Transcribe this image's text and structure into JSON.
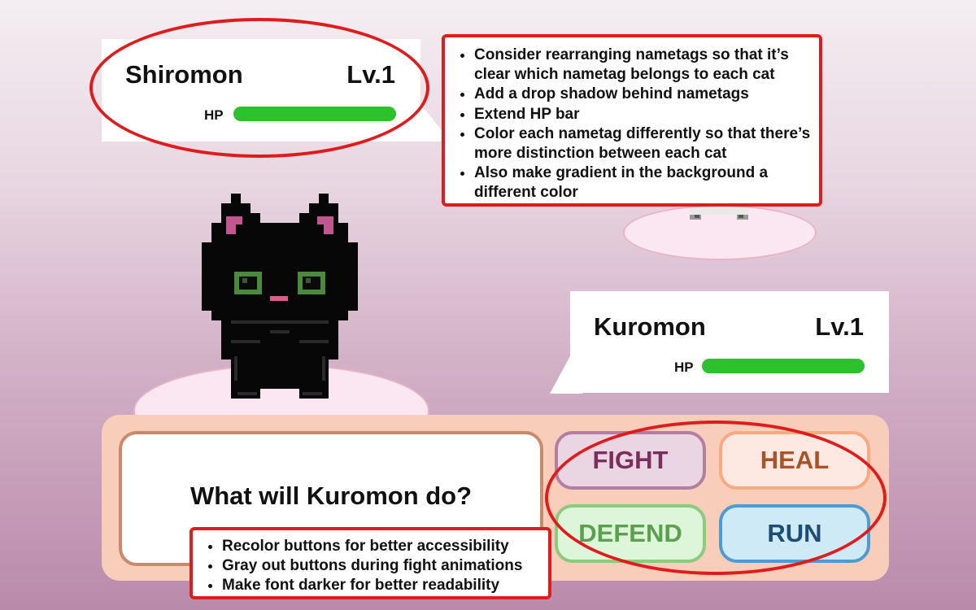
{
  "enemy": {
    "name": "Shiromon",
    "level": "Lv.1",
    "hp_label": "HP",
    "hp_fraction": 1.0
  },
  "player": {
    "name": "Kuromon",
    "level": "Lv.1",
    "hp_label": "HP",
    "hp_fraction": 1.0
  },
  "battle": {
    "prompt": "What will Kuromon do?",
    "buttons": {
      "fight": "FIGHT",
      "heal": "HEAL",
      "defend": "DEFEND",
      "run": "RUN"
    }
  },
  "annotations": {
    "top_notes": [
      "Consider rearranging nametags so that it’s clear which nametag belongs to each cat",
      "Add a drop shadow behind nametags",
      "Extend HP bar",
      "Color each nametag differently so that there’s more distinction between each cat",
      "Also make gradient in the background a different color"
    ],
    "bottom_notes": [
      "Recolor buttons for better accessibility",
      "Gray out buttons during fight animations",
      "Make font darker for better readability"
    ]
  },
  "colors": {
    "hp_bar": "#2dc12d",
    "annotation_red": "#e01b1b",
    "panel": "#f8cdb9"
  }
}
